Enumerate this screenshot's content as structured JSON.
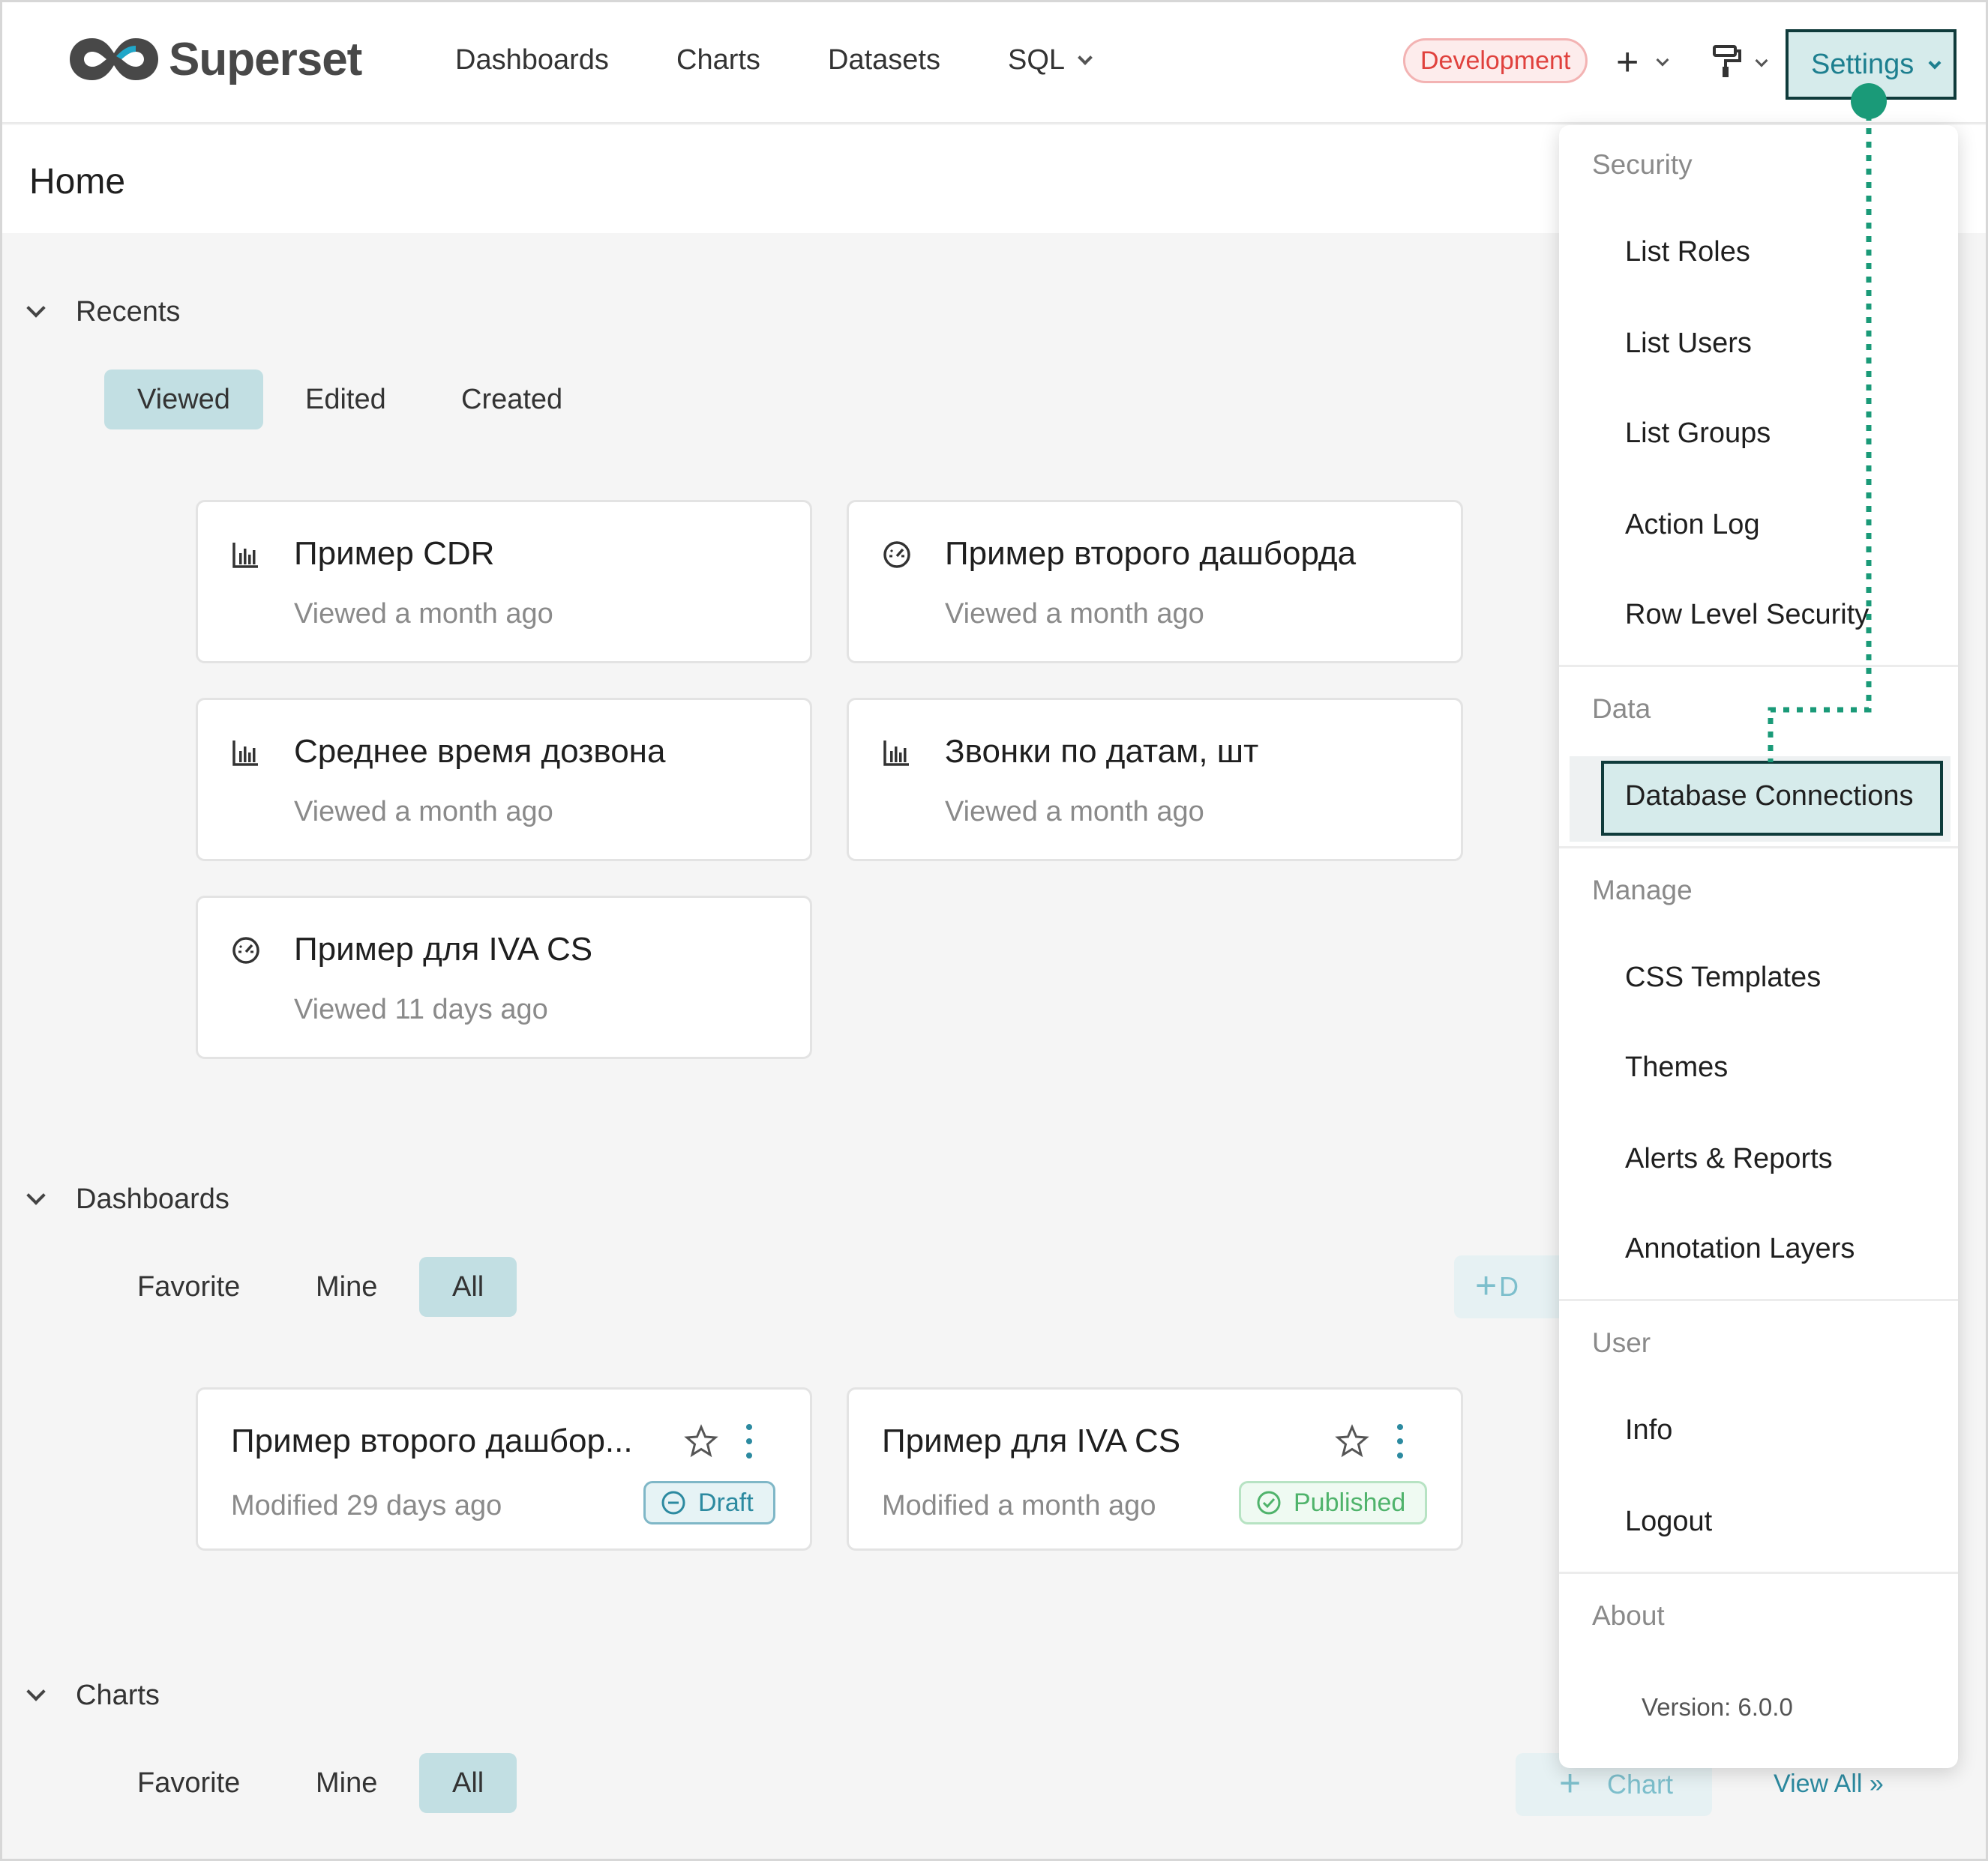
{
  "brand": {
    "name": "Superset"
  },
  "nav": {
    "dashboards": "Dashboards",
    "charts": "Charts",
    "datasets": "Datasets",
    "sql": "SQL",
    "environment": "Development",
    "plus": "+",
    "settings": "Settings"
  },
  "page": {
    "title": "Home"
  },
  "recents": {
    "title": "Recents",
    "tabs": [
      "Viewed",
      "Edited",
      "Created"
    ],
    "cards": [
      {
        "icon": "bar-chart-icon",
        "title": "Пример CDR",
        "sub": "Viewed a month ago"
      },
      {
        "icon": "dashboard-gauge-icon",
        "title": "Пример второго дашборда",
        "sub": "Viewed a month ago"
      },
      {
        "icon": "bar-chart-icon",
        "title": "Среднее время дозвона",
        "sub": "Viewed a month ago"
      },
      {
        "icon": "bar-chart-icon",
        "title": "Звонки по датам, шт",
        "sub": "Viewed a month ago"
      },
      {
        "icon": "dashboard-gauge-icon",
        "title": "Пример для IVA CS",
        "sub": "Viewed 11 days ago"
      }
    ]
  },
  "dashboards": {
    "title": "Dashboards",
    "tabs": [
      "Favorite",
      "Mine",
      "All"
    ],
    "add_button_partial": "D",
    "cards": [
      {
        "title": "Пример второго дашбор...",
        "sub": "Modified 29 days ago",
        "status": "Draft"
      },
      {
        "title": "Пример для IVA CS",
        "sub": "Modified a month ago",
        "status": "Published"
      }
    ]
  },
  "charts": {
    "title": "Charts",
    "tabs": [
      "Favorite",
      "Mine",
      "All"
    ],
    "add_button": "Chart",
    "view_all": "View All »"
  },
  "settings_menu": {
    "groups": {
      "security": "Security",
      "data": "Data",
      "manage": "Manage",
      "user": "User",
      "about": "About"
    },
    "security_items": [
      "List Roles",
      "List Users",
      "List Groups",
      "Action Log",
      "Row Level Security"
    ],
    "data_items": [
      "Database Connections"
    ],
    "manage_items": [
      "CSS Templates",
      "Themes",
      "Alerts & Reports",
      "Annotation Layers"
    ],
    "user_items": [
      "Info",
      "Logout"
    ],
    "version": "Version: 6.0.0"
  },
  "colors": {
    "accent": "#1d7f8f",
    "active_tab": "#c2dfe3",
    "highlight_border": "#0f3b3b",
    "annotation": "#1a9a78",
    "env_badge": "#e0413d"
  }
}
